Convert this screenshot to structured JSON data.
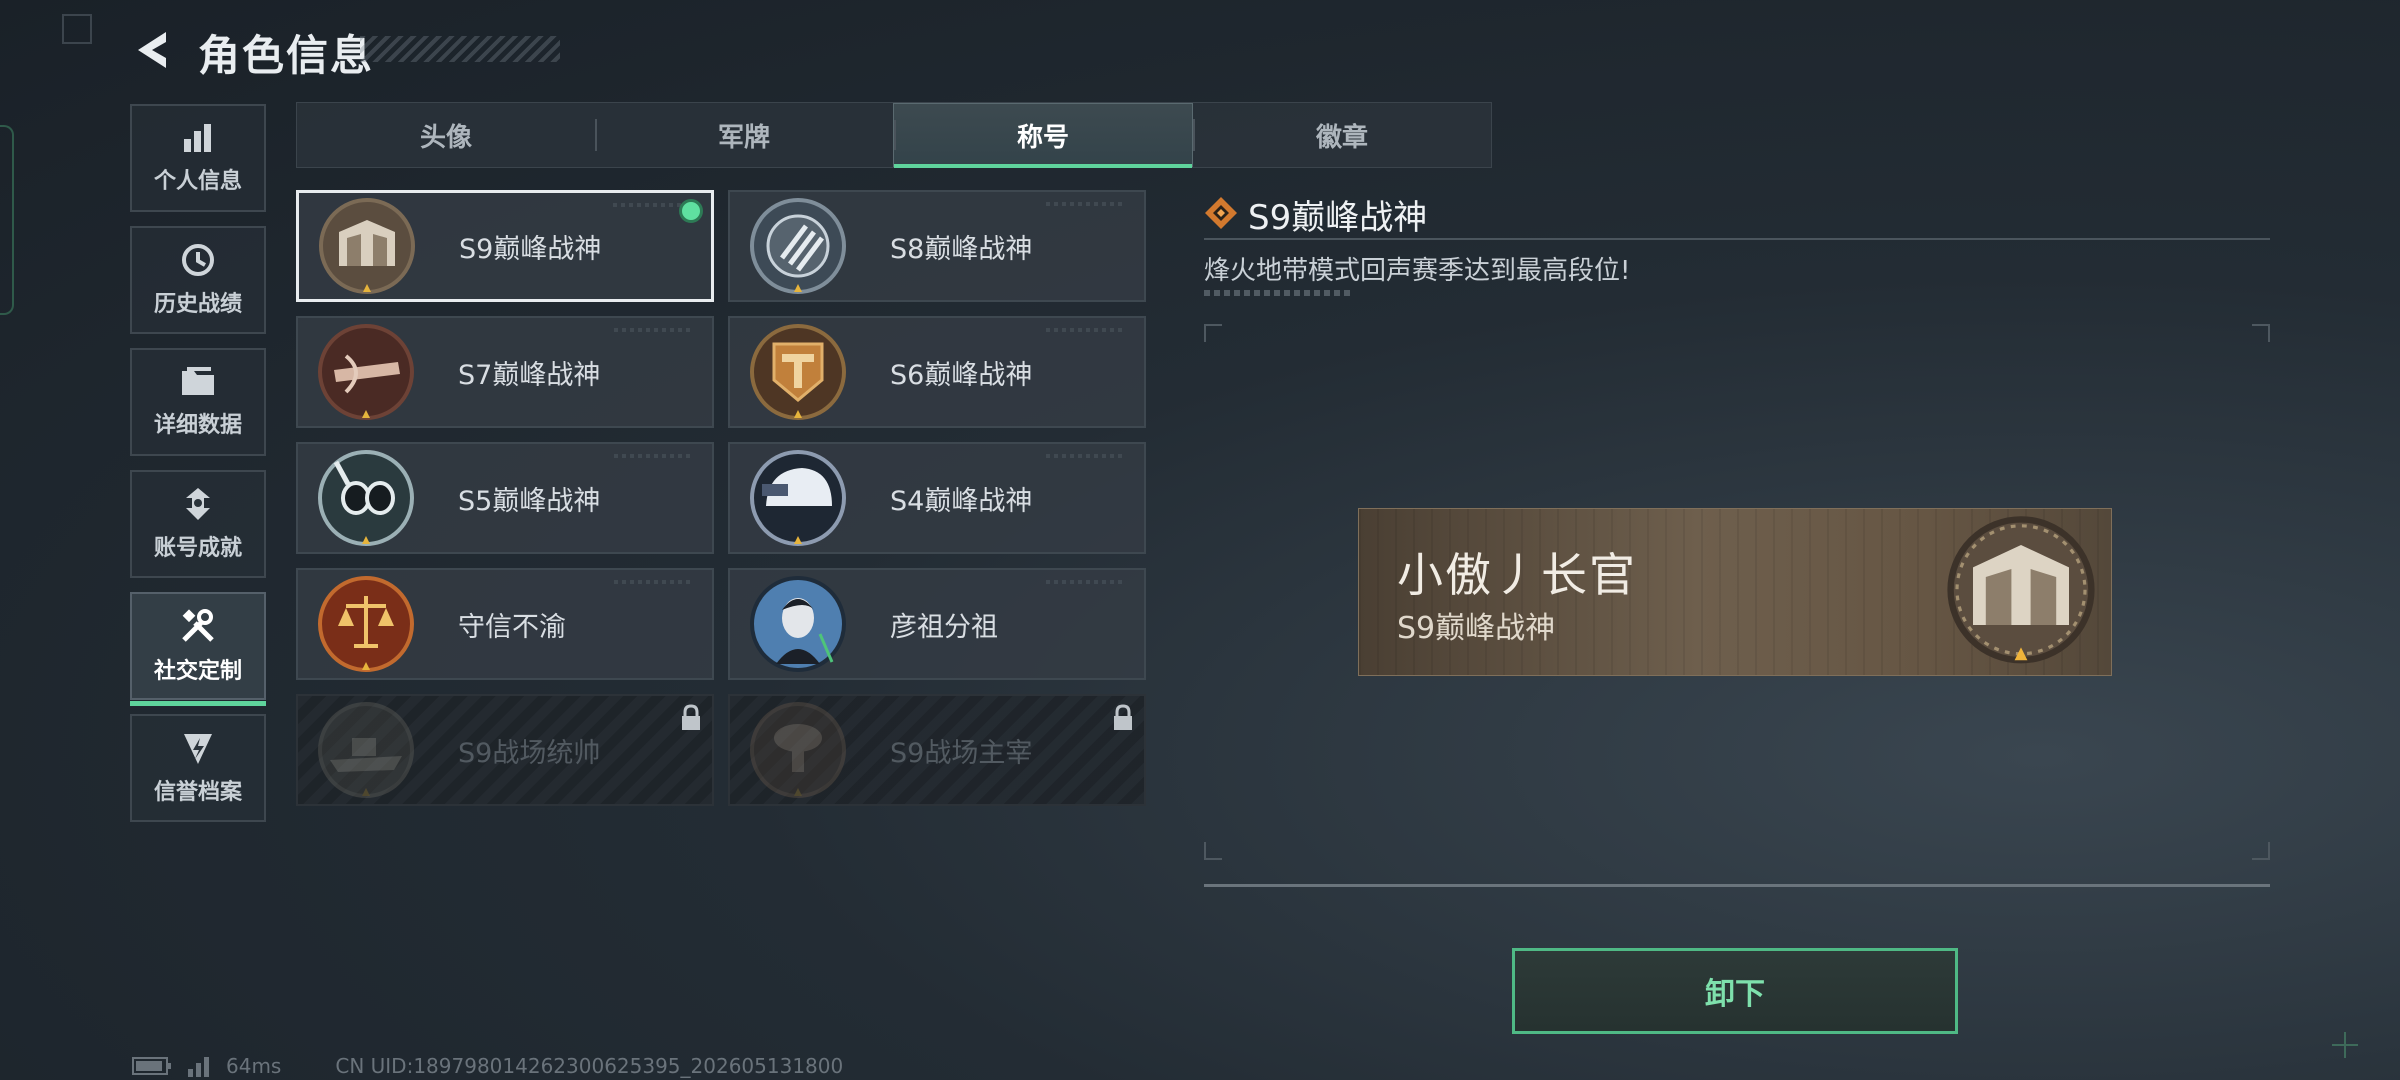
{
  "header": {
    "title": "角色信息"
  },
  "sidebar": {
    "items": [
      {
        "label": "个人信息",
        "icon": "bar-chart-icon"
      },
      {
        "label": "历史战绩",
        "icon": "clock-history-icon"
      },
      {
        "label": "详细数据",
        "icon": "folder-icon"
      },
      {
        "label": "账号成就",
        "icon": "achievement-icon"
      },
      {
        "label": "社交定制",
        "icon": "tools-icon",
        "active": true
      },
      {
        "label": "信誉档案",
        "icon": "shield-bolt-icon"
      }
    ]
  },
  "tabs": [
    {
      "label": "头像"
    },
    {
      "label": "军牌"
    },
    {
      "label": "称号",
      "active": true
    },
    {
      "label": "徽章"
    }
  ],
  "titles": [
    {
      "name": "S9巅峰战神",
      "medal": "fortress-medal-icon",
      "selected": true,
      "equipped": true
    },
    {
      "name": "S8巅峰战神",
      "medal": "slashes-medal-icon"
    },
    {
      "name": "S7巅峰战神",
      "medal": "crossbow-medal-icon"
    },
    {
      "name": "S6巅峰战神",
      "medal": "t-emblem-medal-icon"
    },
    {
      "name": "S5巅峰战神",
      "medal": "diving-mask-medal-icon"
    },
    {
      "name": "S4巅峰战神",
      "medal": "helmet-medal-icon"
    },
    {
      "name": "守信不渝",
      "medal": "scales-medal-icon"
    },
    {
      "name": "彦祖分祖",
      "medal": "portrait-medal-icon"
    },
    {
      "name": "S9战场统帅",
      "medal": "warship-medal-icon",
      "locked": true
    },
    {
      "name": "S9战场主宰",
      "medal": "mushroom-cloud-medal-icon",
      "locked": true
    }
  ],
  "detail": {
    "title": "S9巅峰战神",
    "description": "烽火地带模式回声赛季达到最高段位!"
  },
  "preview": {
    "player_name": "小傲丿长官",
    "title": "S9巅峰战神"
  },
  "unequip_label": "卸下",
  "footer": {
    "ping": "64ms",
    "uid": "CN UID:18979801426230062539­5_202605131800"
  },
  "colors": {
    "accent": "#5fd49c",
    "plate": "#6e5f4d"
  }
}
